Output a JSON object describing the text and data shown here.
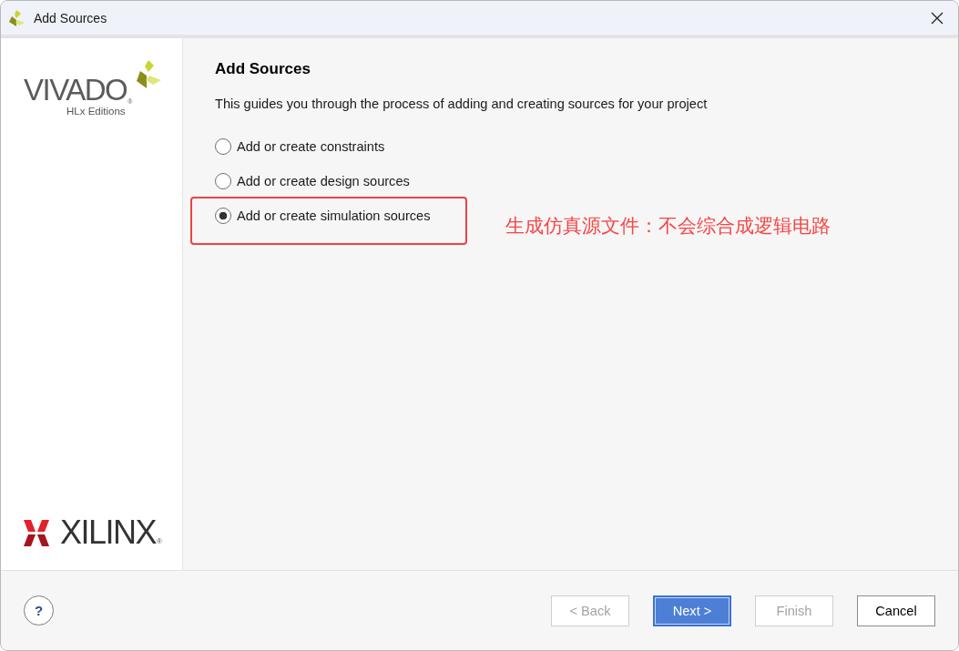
{
  "window": {
    "title": "Add Sources"
  },
  "sidebar": {
    "product_logo": {
      "name": "VIVADO",
      "registered": "®",
      "edition": "HLx Editions"
    },
    "company_logo": {
      "name": "XILINX",
      "registered": "®"
    }
  },
  "page": {
    "heading": "Add Sources",
    "description": "This guides you through the process of adding and creating sources for your project",
    "options": [
      {
        "label": "Add or create constraints",
        "selected": false,
        "highlighted": false
      },
      {
        "label": "Add or create design sources",
        "selected": false,
        "highlighted": false
      },
      {
        "label": "Add or create simulation sources",
        "selected": true,
        "highlighted": true,
        "note": "生成仿真源文件：不会综合成逻辑电路"
      }
    ]
  },
  "footer": {
    "help_button": "?",
    "buttons": [
      {
        "label": "< Back",
        "disabled": true,
        "default": false
      },
      {
        "label": "Next >",
        "disabled": false,
        "default": true
      },
      {
        "label": "Finish",
        "disabled": true,
        "default": false
      },
      {
        "label": "Cancel",
        "disabled": false,
        "default": false
      }
    ]
  }
}
